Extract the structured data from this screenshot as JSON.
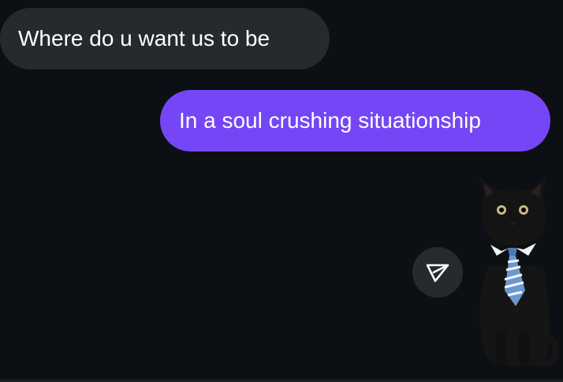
{
  "messages": [
    {
      "direction": "incoming",
      "text": "Where do u want us to be"
    },
    {
      "direction": "outgoing",
      "text": "In a soul crushing situationship"
    }
  ],
  "share": {
    "icon": "paper-plane-icon"
  },
  "sticker": {
    "subject": "black cat wearing blue striped tie",
    "icon": "cat-sticker"
  },
  "colors": {
    "background": "#0c1014",
    "incoming_bubble": "#262a2e",
    "outgoing_bubble": "#7546f5",
    "text": "#ffffff"
  }
}
